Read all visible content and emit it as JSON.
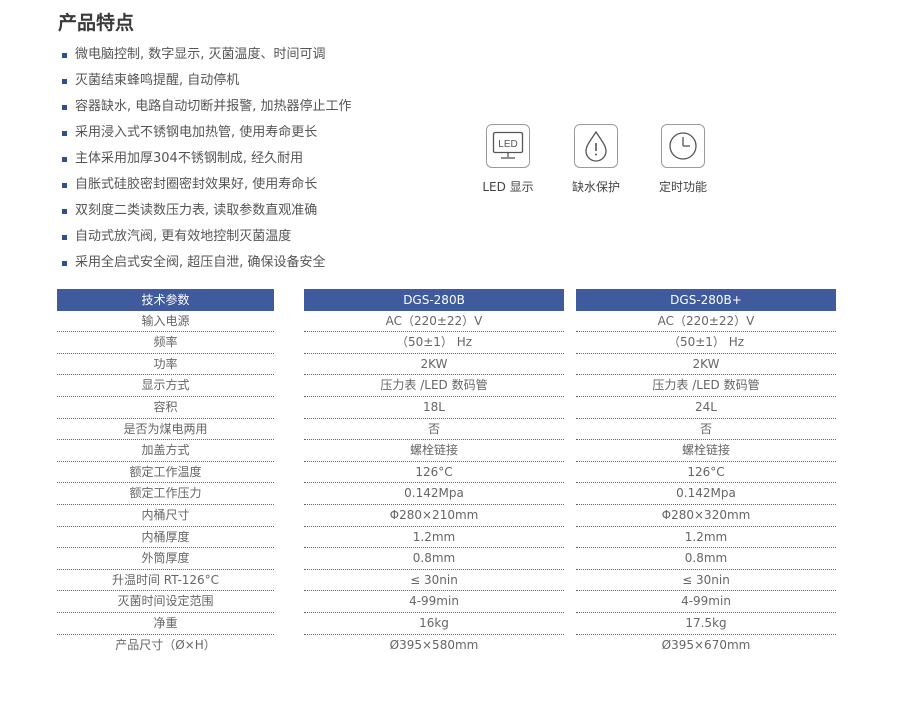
{
  "title": "产品特点",
  "features": [
    "微电脑控制, 数字显示, 灭菌温度、时间可调",
    "灭菌结束蜂鸣提醒, 自动停机",
    "容器缺水, 电路自动切断并报警, 加热器停止工作",
    "采用浸入式不锈钢电加热管, 使用寿命更长",
    "主体采用加厚304不锈钢制成, 经久耐用",
    "自胀式硅胶密封圈密封效果好, 使用寿命长",
    "双刻度二类读数压力表, 读取参数直观准确",
    "自动式放汽阀, 更有效地控制灭菌温度",
    "采用全启式安全阀, 超压自泄, 确保设备安全"
  ],
  "icons": [
    {
      "icon": "led-display-icon",
      "label": "LED 显示",
      "text": "LED"
    },
    {
      "icon": "water-shortage-icon",
      "label": "缺水保护"
    },
    {
      "icon": "clock-icon",
      "label": "定时功能"
    }
  ],
  "table": {
    "headers": [
      "技术参数",
      "DGS-280B",
      "DGS-280B+"
    ],
    "rows": [
      [
        "输入电源",
        "AC（220±22）V",
        "AC（220±22）V"
      ],
      [
        "频率",
        "（50±1） Hz",
        "（50±1） Hz"
      ],
      [
        "功率",
        "2KW",
        "2KW"
      ],
      [
        "显示方式",
        "压力表 /LED 数码管",
        "压力表 /LED 数码管"
      ],
      [
        "容积",
        "18L",
        "24L"
      ],
      [
        "是否为煤电两用",
        "否",
        "否"
      ],
      [
        "加盖方式",
        "螺栓链接",
        "螺栓链接"
      ],
      [
        "额定工作温度",
        "126°C",
        "126°C"
      ],
      [
        "额定工作压力",
        "0.142Mpa",
        "0.142Mpa"
      ],
      [
        "内桶尺寸",
        "Φ280×210mm",
        "Φ280×320mm"
      ],
      [
        "内桶厚度",
        "1.2mm",
        "1.2mm"
      ],
      [
        "外筒厚度",
        "0.8mm",
        "0.8mm"
      ],
      [
        "升温时间 RT-126°C",
        "≤ 30nin",
        "≤ 30nin"
      ],
      [
        "灭菌时间设定范围",
        "4-99min",
        "4-99min"
      ],
      [
        "净重",
        "16kg",
        "17.5kg"
      ],
      [
        "产品尺寸（Ø×H）",
        "Ø395×580mm",
        "Ø395×670mm"
      ]
    ]
  },
  "colors": {
    "accent": "#3f5a9d",
    "bullet": "#2f4f93"
  }
}
